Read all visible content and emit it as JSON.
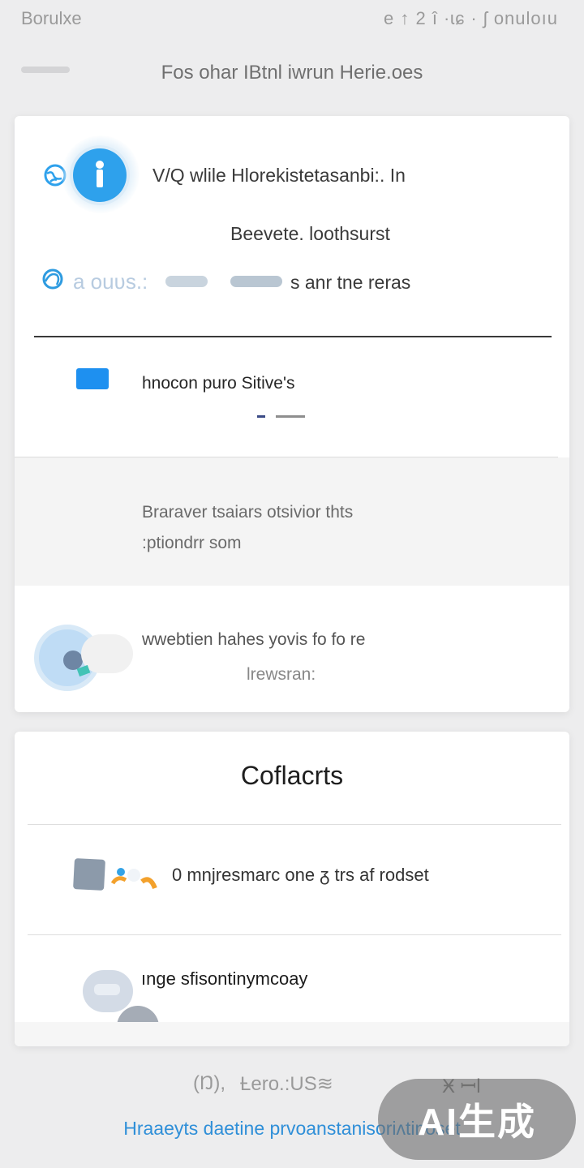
{
  "status_bar": {
    "left_text": "Borulxe",
    "right_text": "e ↑ 2 î ·ɩɕ · ʃ onuloıu"
  },
  "page_header": {
    "title": "Fos ohar IBtnl iwrun Herie.oes"
  },
  "info_section": {
    "line1": "V/Q wlile Hlorekistetasanbi:. In",
    "line2": "Beevete. loothsurst",
    "line3_lead": "a ouʋs.:",
    "line3": "s anr tne reras"
  },
  "service_row": {
    "label": "hnocon puro Sitive's"
  },
  "notice_row": {
    "line1": "Braraver tsaiars otsivior thts",
    "line2": ":ptiondrr som"
  },
  "feature_row": {
    "line1": "wwebtien hahes yovis fo fo re",
    "line2": "lrewsran:"
  },
  "contacts_card": {
    "title": "Coflacrts",
    "item1": "0 mnjresmarc one ᵹ trs af rodset",
    "item2": "ınge sfisontinymcoay"
  },
  "footer": {
    "left": "(Ŋ),",
    "middle": "Ƚero.:US≋",
    "right": "Ӿ ꟷl",
    "link": "Hraaeyts daetine prvoanstanisoriʌtinoset"
  },
  "watermark": {
    "text": "AI生成"
  },
  "colors": {
    "accent_blue": "#2ea1ec",
    "service_blue": "#1e90f0",
    "link_blue": "#2f8fd8",
    "background": "#ededee"
  },
  "icons": [
    "globe-icon",
    "info-icon",
    "folder-icon",
    "avatar",
    "contact-avatar"
  ]
}
